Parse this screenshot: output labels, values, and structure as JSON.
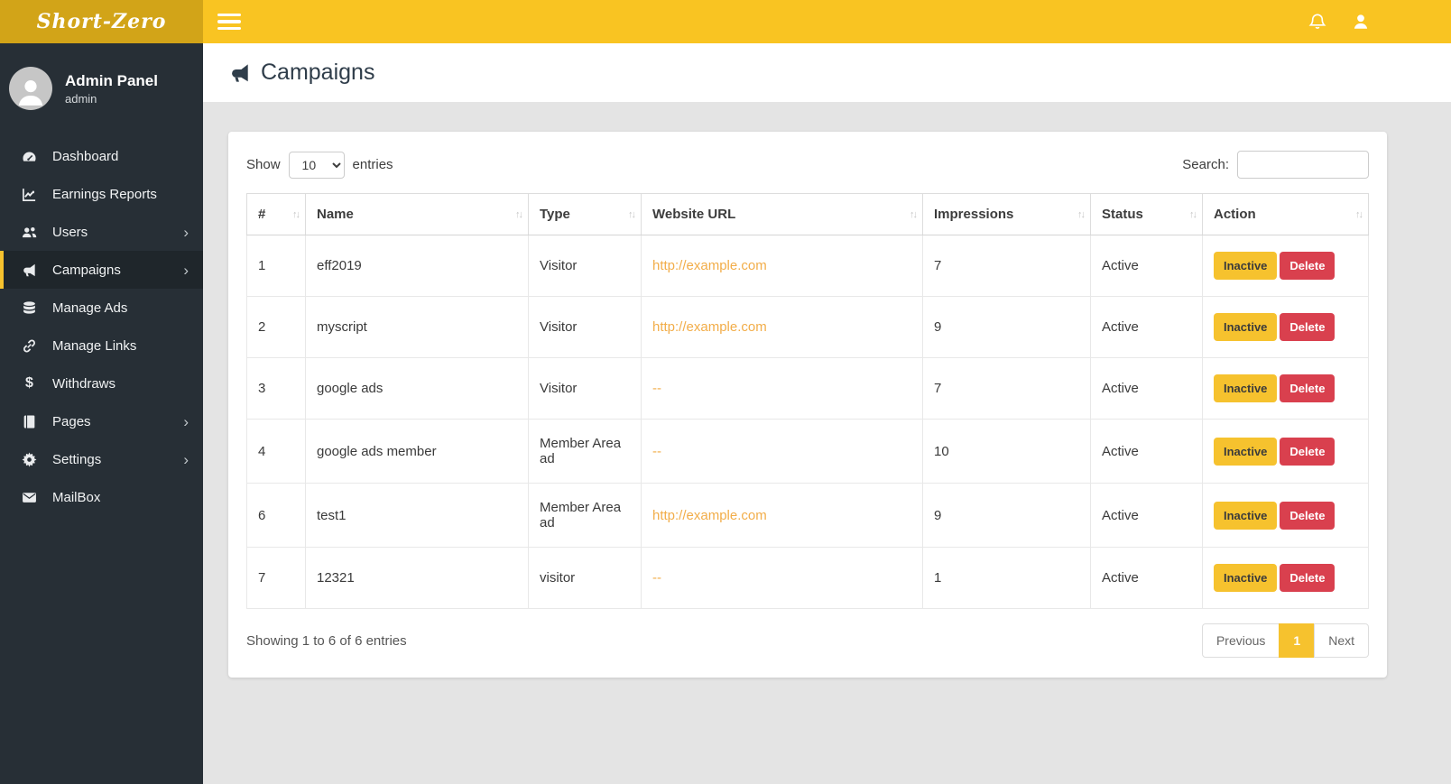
{
  "topbar": {
    "logo": "Short-Zero"
  },
  "sidebar": {
    "profile": {
      "name": "Admin Panel",
      "role": "admin"
    },
    "items": [
      {
        "label": "Dashboard",
        "icon": "dashboard",
        "chevron": false,
        "active": false
      },
      {
        "label": "Earnings Reports",
        "icon": "chart",
        "chevron": false,
        "active": false
      },
      {
        "label": "Users",
        "icon": "users",
        "chevron": true,
        "active": false
      },
      {
        "label": "Campaigns",
        "icon": "bullhorn",
        "chevron": true,
        "active": true
      },
      {
        "label": "Manage Ads",
        "icon": "database",
        "chevron": false,
        "active": false
      },
      {
        "label": "Manage Links",
        "icon": "link",
        "chevron": false,
        "active": false
      },
      {
        "label": "Withdraws",
        "icon": "dollar",
        "chevron": false,
        "active": false
      },
      {
        "label": "Pages",
        "icon": "book",
        "chevron": true,
        "active": false
      },
      {
        "label": "Settings",
        "icon": "gear",
        "chevron": true,
        "active": false
      },
      {
        "label": "MailBox",
        "icon": "envelope",
        "chevron": false,
        "active": false
      }
    ]
  },
  "page": {
    "title": "Campaigns"
  },
  "controls": {
    "show_label": "Show",
    "page_length": "10",
    "entries_label": "entries",
    "search_label": "Search:",
    "search_value": ""
  },
  "table": {
    "columns": [
      "#",
      "Name",
      "Type",
      "Website URL",
      "Impressions",
      "Status",
      "Action"
    ],
    "rows": [
      {
        "id": "1",
        "name": "eff2019",
        "type": "Visitor",
        "url": "http://example.com",
        "impressions": "7",
        "status": "Active"
      },
      {
        "id": "2",
        "name": "myscript",
        "type": "Visitor",
        "url": "http://example.com",
        "impressions": "9",
        "status": "Active"
      },
      {
        "id": "3",
        "name": "google ads",
        "type": "Visitor",
        "url": "--",
        "impressions": "7",
        "status": "Active"
      },
      {
        "id": "4",
        "name": "google ads member",
        "type": "Member Area ad",
        "url": "--",
        "impressions": "10",
        "status": "Active"
      },
      {
        "id": "6",
        "name": "test1",
        "type": "Member Area ad",
        "url": "http://example.com",
        "impressions": "9",
        "status": "Active"
      },
      {
        "id": "7",
        "name": "12321",
        "type": "visitor",
        "url": "--",
        "impressions": "1",
        "status": "Active"
      }
    ],
    "action_labels": {
      "inactive": "Inactive",
      "delete": "Delete"
    }
  },
  "footer": {
    "info": "Showing 1 to 6 of 6 entries",
    "pagination": {
      "previous": "Previous",
      "current_page": "1",
      "next": "Next"
    }
  },
  "colors": {
    "topbar_bg": "#f9c422",
    "logo_bg": "#d2a418",
    "sidebar_bg": "#272f36",
    "sidebar_active_bg": "#1f262b",
    "accent_yellow": "#f6c22e",
    "link_orange": "#f2ad49",
    "delete_red": "#d9404e",
    "title_color": "#2f3d4a",
    "content_bg": "#e4e4e4"
  }
}
